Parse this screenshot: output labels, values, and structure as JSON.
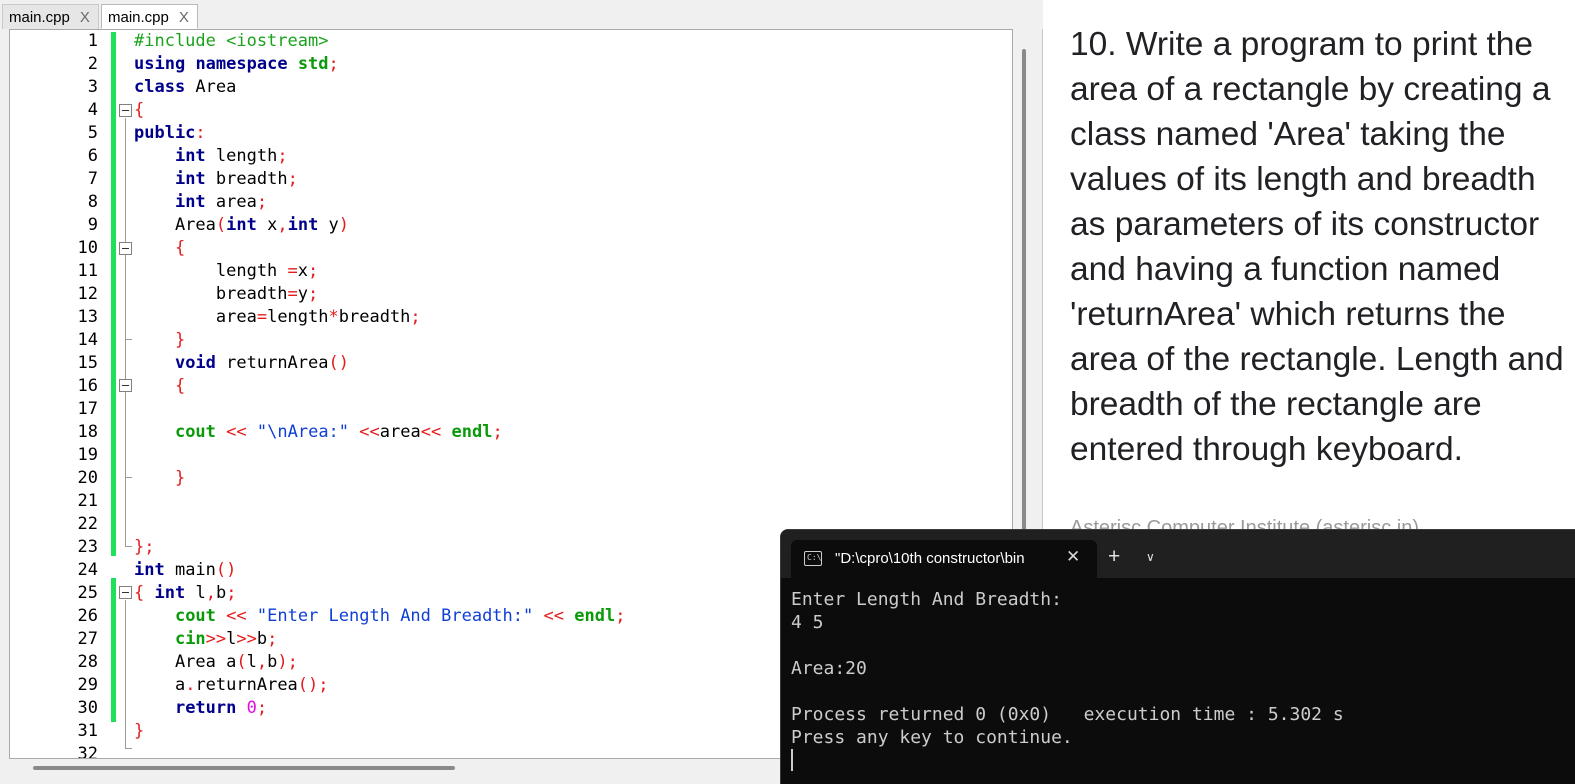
{
  "editor": {
    "tabs": [
      {
        "label": "main.cpp",
        "close": "X"
      },
      {
        "label": "main.cpp",
        "close": "X"
      }
    ],
    "line_numbers": [
      "1",
      "2",
      "3",
      "4",
      "5",
      "6",
      "7",
      "8",
      "9",
      "10",
      "11",
      "12",
      "13",
      "14",
      "15",
      "16",
      "17",
      "18",
      "19",
      "20",
      "21",
      "22",
      "23",
      "24",
      "25",
      "26",
      "27",
      "28",
      "29",
      "30",
      "31",
      "32"
    ],
    "code": [
      "#include <iostream>",
      "using namespace std;",
      "class Area",
      "{",
      "public:",
      "    int length;",
      "    int breadth;",
      "    int area;",
      "    Area(int x,int y)",
      "    {",
      "        length =x;",
      "        breadth=y;",
      "        area=length*breadth;",
      "    }",
      "    void returnArea()",
      "    {",
      "",
      "    cout << \"\\nArea:\" <<area<< endl;",
      "",
      "    }",
      "",
      "",
      "};",
      "int main()",
      "{ int l,b;",
      "    cout << \"Enter Length And Breadth:\" << endl;",
      "    cin>>l>>b;",
      "    Area a(l,b);",
      "    a.returnArea();",
      "    return 0;",
      "}",
      ""
    ]
  },
  "question": {
    "text": "10. Write a program to print the area of a rectangle by creating a class named 'Area' taking the values of its length and breadth as parameters of its constructor and having a function named 'returnArea' which returns the area of the rectangle. Length and breadth of the rectangle are entered through keyboard.",
    "cut_line": "Asterisc Computer Institute (asterisc.in)"
  },
  "terminal": {
    "icon": "terminal-icon",
    "tab_title": "\"D:\\cpro\\10th constructor\\bin",
    "close": "✕",
    "new_tab": "+",
    "dropdown": "⌄",
    "output": [
      "Enter Length And Breadth:",
      "4 5",
      "",
      "Area:20",
      "",
      "Process returned 0 (0x0)   execution time : 5.302 s",
      "Press any key to continue."
    ]
  },
  "colors": {
    "keyword": "#00008b",
    "operator": "#e31b1b",
    "preprocessor": "#1aa31a",
    "string": "#0f3fd6",
    "std_identifier": "#0a9a0a",
    "number": "#e010e0",
    "changebar": "#1fe05a",
    "terminal_bg": "#0c0c0c"
  }
}
